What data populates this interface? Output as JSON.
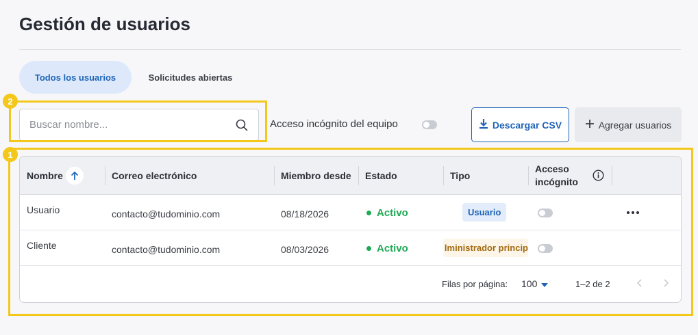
{
  "page": {
    "title": "Gestión de usuarios"
  },
  "tabs": [
    {
      "label": "Todos los usuarios",
      "active": true
    },
    {
      "label": "Solicitudes abiertas",
      "active": false
    }
  ],
  "toolbar": {
    "search_placeholder": "Buscar nombre...",
    "search_value": "",
    "team_incognito_label": "Acceso incógnito del equipo",
    "team_incognito_on": false,
    "download_label": "Descargar CSV",
    "add_label": "Agregar usuarios"
  },
  "annotations": [
    {
      "number": "1",
      "target": "table"
    },
    {
      "number": "2",
      "target": "search"
    }
  ],
  "table": {
    "columns": {
      "name": "Nombre",
      "email": "Correo electrónico",
      "member_since": "Miembro desde",
      "status": "Estado",
      "type": "Tipo",
      "incognito_line1": "Acceso",
      "incognito_line2": "incógnito"
    },
    "sort": {
      "column": "name",
      "direction": "ascending"
    },
    "rows": [
      {
        "name": "Usuario",
        "email": "contacto@tudominio.com",
        "member_since": "08/18/2026",
        "status": "Activo",
        "type": "Usuario",
        "incognito": false
      },
      {
        "name": "Cliente",
        "email": "contacto@tudominio.com",
        "member_since": "08/03/2026",
        "status": "Activo",
        "type": "lministrador princip",
        "incognito": false
      }
    ],
    "footer": {
      "rows_per_page_label": "Filas por página:",
      "rows_per_page_value": "100",
      "range": "1–2 de 2"
    }
  },
  "colors": {
    "accent": "#1f64b8",
    "status_active": "#1eaa55",
    "highlight": "#f3c81b"
  }
}
